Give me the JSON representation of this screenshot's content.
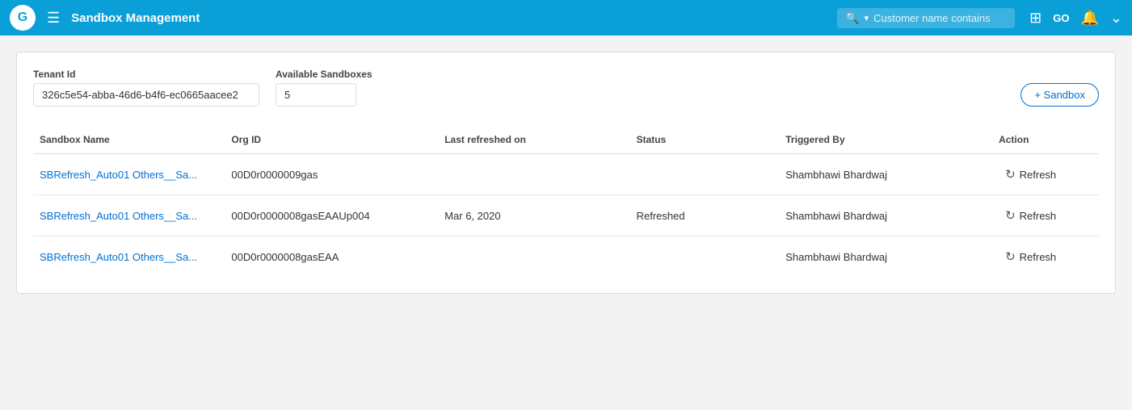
{
  "nav": {
    "logo": "G",
    "menu_label": "☰",
    "title": "Sandbox Management",
    "search_placeholder": "Customer name contains",
    "icons": [
      "grid",
      "go",
      "bell",
      "chevron-down"
    ]
  },
  "tenant": {
    "id_label": "Tenant Id",
    "id_value": "326c5e54-abba-46d6-b4f6-ec0665aacee2",
    "sandboxes_label": "Available Sandboxes",
    "sandboxes_value": "5",
    "add_button": "+ Sandbox"
  },
  "table": {
    "columns": [
      {
        "key": "sandbox_name",
        "label": "Sandbox Name"
      },
      {
        "key": "org_id",
        "label": "Org ID"
      },
      {
        "key": "last_refreshed",
        "label": "Last refreshed on"
      },
      {
        "key": "status",
        "label": "Status"
      },
      {
        "key": "triggered_by",
        "label": "Triggered By"
      },
      {
        "key": "action",
        "label": "Action"
      }
    ],
    "rows": [
      {
        "sandbox_name": "SBRefresh_Auto01 Others__Sa...",
        "org_id": "00D0r0000009gas",
        "last_refreshed": "",
        "status": "",
        "triggered_by": "Shambhawi Bhardwaj",
        "action": "Refresh"
      },
      {
        "sandbox_name": "SBRefresh_Auto01 Others__Sa...",
        "org_id": "00D0r0000008gasEAAUp004",
        "last_refreshed": "Mar 6, 2020",
        "status": "Refreshed",
        "triggered_by": "Shambhawi Bhardwaj",
        "action": "Refresh"
      },
      {
        "sandbox_name": "SBRefresh_Auto01 Others__Sa...",
        "org_id": "00D0r0000008gasEAA",
        "last_refreshed": "",
        "status": "",
        "triggered_by": "Shambhawi Bhardwaj",
        "action": "Refresh"
      }
    ]
  }
}
